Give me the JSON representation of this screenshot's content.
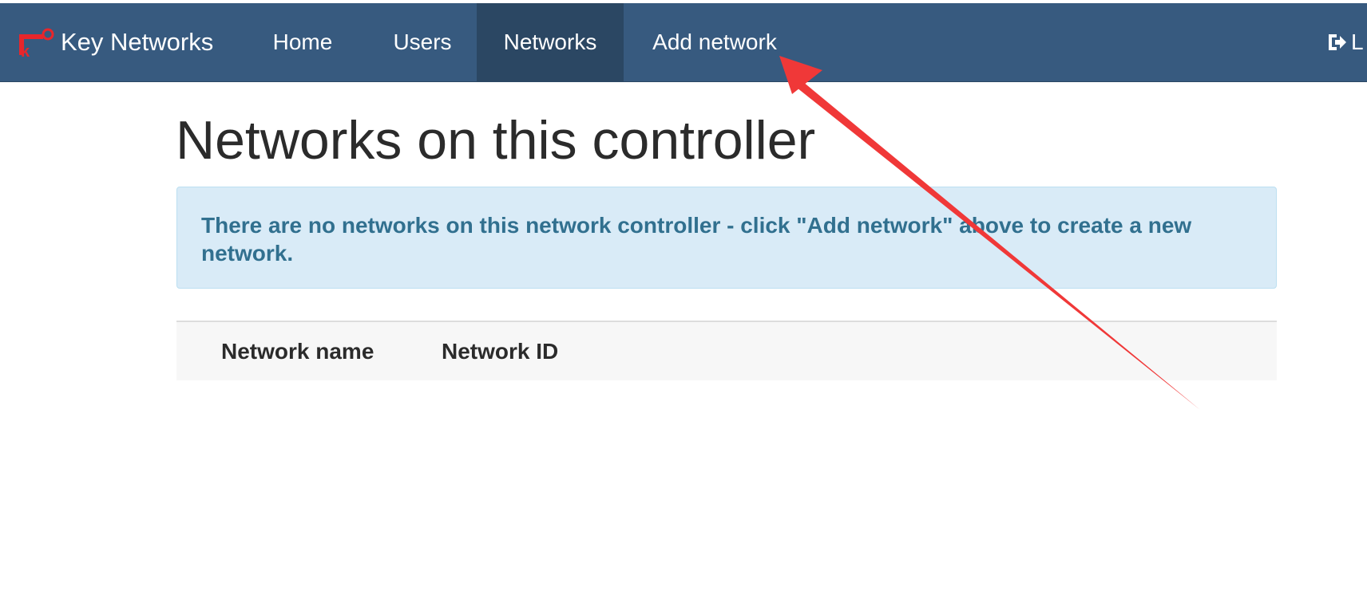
{
  "navbar": {
    "brand_label": "Key Networks",
    "brand_icon": "key-icon",
    "items": [
      {
        "label": "Home"
      },
      {
        "label": "Users"
      },
      {
        "label": "Networks",
        "active": true
      },
      {
        "label": "Add network"
      }
    ],
    "logout_icon": "sign-out-icon",
    "logout_label": "L"
  },
  "main": {
    "title": "Networks on this controller",
    "alert": "There are no networks on this network controller - click \"Add network\" above to create a new network.",
    "table": {
      "columns": [
        "Network name",
        "Network ID"
      ],
      "rows": []
    }
  },
  "annotation": {
    "arrow_color": "#f03838"
  },
  "colors": {
    "navbar": "#375a7f",
    "navbar_active": "#2b4763",
    "alert_bg": "#d9ebf7",
    "alert_text": "#31708f"
  }
}
